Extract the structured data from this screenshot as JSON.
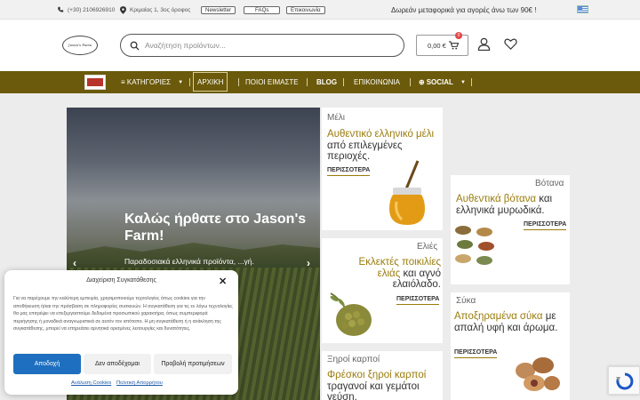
{
  "topbar": {
    "phone": "(+30) 2106926910",
    "address": "Κριμαίας 1, 3ος όροφος",
    "newsletter": "Newsletter",
    "faqs": "FAQs",
    "contact": "Επικοινωνία",
    "shipping": "Δωρεάν μεταφορικά για αγορές άνω των 90€ !",
    "logo_text": "Jason's Farm"
  },
  "header": {
    "search_placeholder": "Αναζήτηση προϊόντων...",
    "cart_total": "0,00 €",
    "cart_count": "0"
  },
  "nav": {
    "categories": "≡ ΚΑΤΗΓΟΡΙΕΣ",
    "home": "ΑΡΧΙΚΗ",
    "about": "ΠΟΙΟΙ ΕΙΜΑΣΤΕ",
    "blog": "BLOG",
    "contact": "ΕΠΙΚΟΙΝΩΝΙΑ",
    "social": "SOCIAL"
  },
  "hero": {
    "title": "Καλώς ήρθατε στο Jason's Farm!",
    "subtitle": "Παραδοσιακά ελληνικά προϊόντα, ...γή."
  },
  "cards": {
    "honey": {
      "category": "Μέλι",
      "head_hl": "Αυθεντικό ελληνικό μέλι",
      "head": " από επιλεγμένες περιοχές.",
      "more": "ΠΕΡΙΣΣΟΤΕΡΑ"
    },
    "herbs": {
      "category": "Βότανα",
      "head_hl": "Αυθεντικά βότανα",
      "head": " και ελληνικά μυρωδικά.",
      "more": "ΠΕΡΙΣΣΟΤΕΡΑ"
    },
    "olives": {
      "category": "Ελιές",
      "head_hl": "Εκλεκτές ποικιλίες ελιάς",
      "head": " και αγνό ελαιόλαδο.",
      "more": "ΠΕΡΙΣΣΟΤΕΡΑ"
    },
    "figs": {
      "category": "Σύκα",
      "head_hl": "Αποξηραμένα σύκα",
      "head": " με απαλή υφή και άρωμα.",
      "more": "ΠΕΡΙΣΣΟΤΕΡΑ"
    },
    "dried": {
      "category": "Ξηροί καρποί",
      "head_hl": "Φρέσκοι ξηροί καρποί",
      "head": " τραγανοί και γεμάτοι γεύση."
    }
  },
  "cookie": {
    "title": "Διαχείριση Συγκατάθεσης",
    "close": "✕",
    "body": "Για να παρέχουμε την καλύτερη εμπειρία, χρησιμοποιούμε τεχνολογίες όπως cookies για την αποθήκευση ή/και την πρόσβαση σε πληροφορίες συσκευών. Η συγκατάθεση για τις εν λόγω τεχνολογίες θα μας επιτρέψει να επεξεργαστούμε δεδομένα προσωπικού χαρακτήρα, όπως συμπεριφορά περιήγησης ή μοναδικά αναγνωριστικά σε αυτόν τον ιστότοπο. Η μη συγκατάθεση ή η ανάκληση της συγκατάθεσης, μπορεί να επηρεάσει αρνητικά ορισμένες λειτουργίες και δυνατότητες.",
    "accept": "Αποδοχή",
    "deny": "Δεν αποδέχομαι",
    "prefs": "Προβολή προτιμήσεων",
    "cookie_policy": "Ανάλυση Cookies",
    "privacy_policy": "Πολιτική Απορρήτου"
  },
  "colors": {
    "brand": "#6b5a0b",
    "accent": "#9a7c0c",
    "accept_button": "#1e6fc0"
  }
}
